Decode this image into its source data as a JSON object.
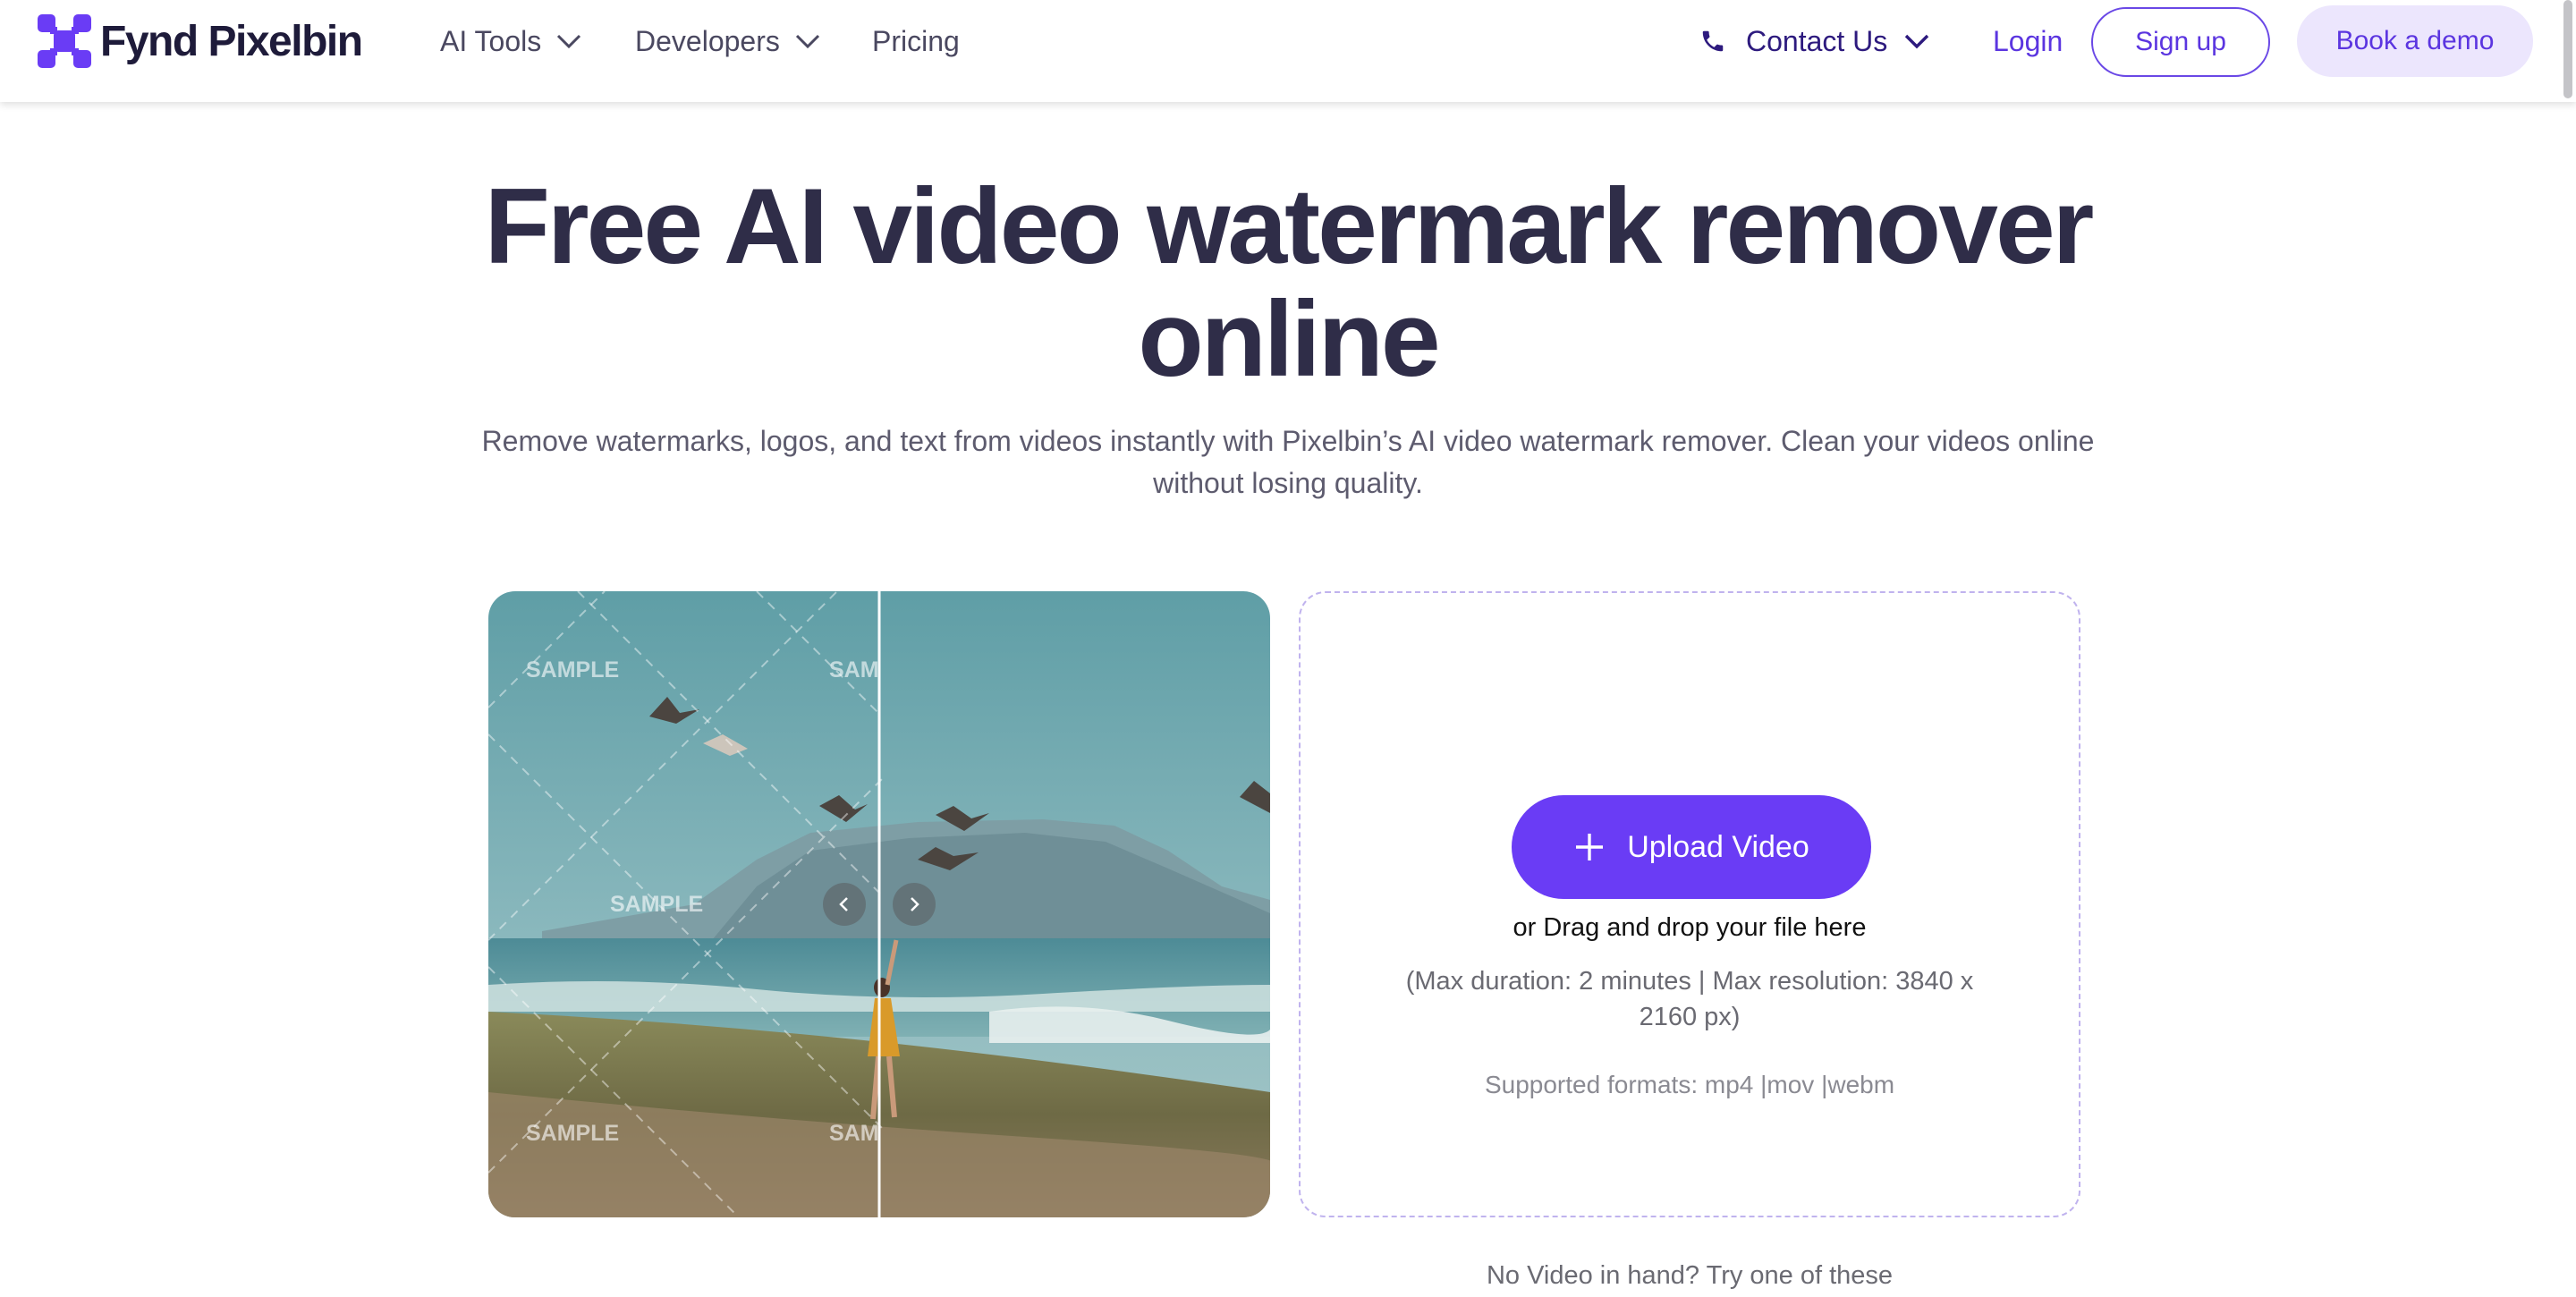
{
  "nav": {
    "brand": "Fynd Pixelbin",
    "items": [
      {
        "label": "AI Tools"
      },
      {
        "label": "Developers"
      },
      {
        "label": "Pricing"
      }
    ],
    "contact_label": "Contact Us",
    "login_label": "Login",
    "signup_label": "Sign up",
    "demo_label": "Book a demo"
  },
  "hero": {
    "title_line1": "Free AI video watermark remover",
    "title_line2": "online",
    "subtitle_line1": "Remove watermarks, logos, and text from videos instantly with Pixelbin’s AI video watermark remover. Clean your videos online",
    "subtitle_line2": "without losing quality."
  },
  "preview": {
    "watermark_text": "SAMPLE",
    "watermark_text_clipped": "SAM"
  },
  "upload": {
    "button_label": "Upload Video",
    "drag_text": "or Drag and drop your file here",
    "limits_text": "(Max duration: 2 minutes | Max resolution: 3840 x 2160 px)",
    "formats_text": "Supported formats: mp4 |mov |webm"
  },
  "samples": {
    "prompt": "No Video in hand? Try one of these"
  },
  "colors": {
    "brand": "#6a3cf5",
    "title": "#2f2d48",
    "contact": "#2d1a7e"
  }
}
